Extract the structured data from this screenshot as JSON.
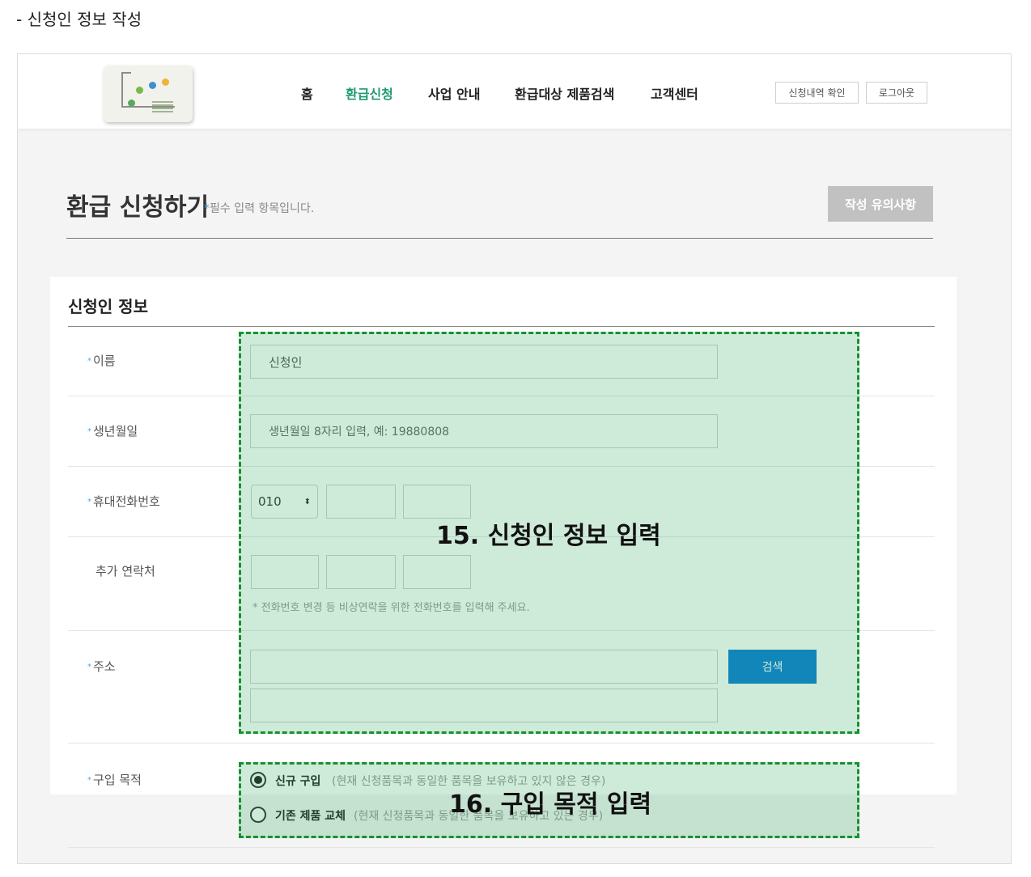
{
  "page_heading": "- 신청인 정보 작성",
  "header": {
    "nav": [
      "홈",
      "환급신청",
      "사업 안내",
      "환급대상 제품검색",
      "고객센터"
    ],
    "active_nav": "환급신청",
    "buttons": {
      "check_history": "신청내역 확인",
      "logout": "로그아웃"
    }
  },
  "form_header": {
    "title": "환급 신청하기",
    "required_note": "필수 입력 항목입니다.",
    "notice_button": "작성 유의사항"
  },
  "section": {
    "title": "신청인 정보",
    "fields": {
      "name": {
        "label": "이름",
        "value": "신청인"
      },
      "birth": {
        "label": "생년월일",
        "placeholder": "생년월일 8자리 입력, 예: 19880808"
      },
      "phone": {
        "label": "휴대전화번호",
        "prefix": "010"
      },
      "extra_contact": {
        "label": "추가 연락처",
        "hint": "* 전화번호 변경 등 비상연락을 위한 전화번호를 입력해 주세요."
      },
      "address": {
        "label": "주소",
        "search_button": "검색"
      },
      "purpose": {
        "label": "구입 목적",
        "options": [
          {
            "label": "신규 구입",
            "desc": "(현재 신청품목과 동일한 품목을 보유하고 있지 않은 경우)",
            "selected": true
          },
          {
            "label": "기존 제품 교체",
            "desc": "(현재 신청품목과 동일한 품목을 보유하고 있는 경우)",
            "selected": false
          }
        ]
      }
    }
  },
  "annotations": {
    "step15": "15. 신청인 정보 입력",
    "step16": "16. 구입 목적 입력"
  },
  "colors": {
    "accent_green": "#1d9a6c",
    "search_blue": "#0f7fd6",
    "annotation_green": "#16912f"
  }
}
